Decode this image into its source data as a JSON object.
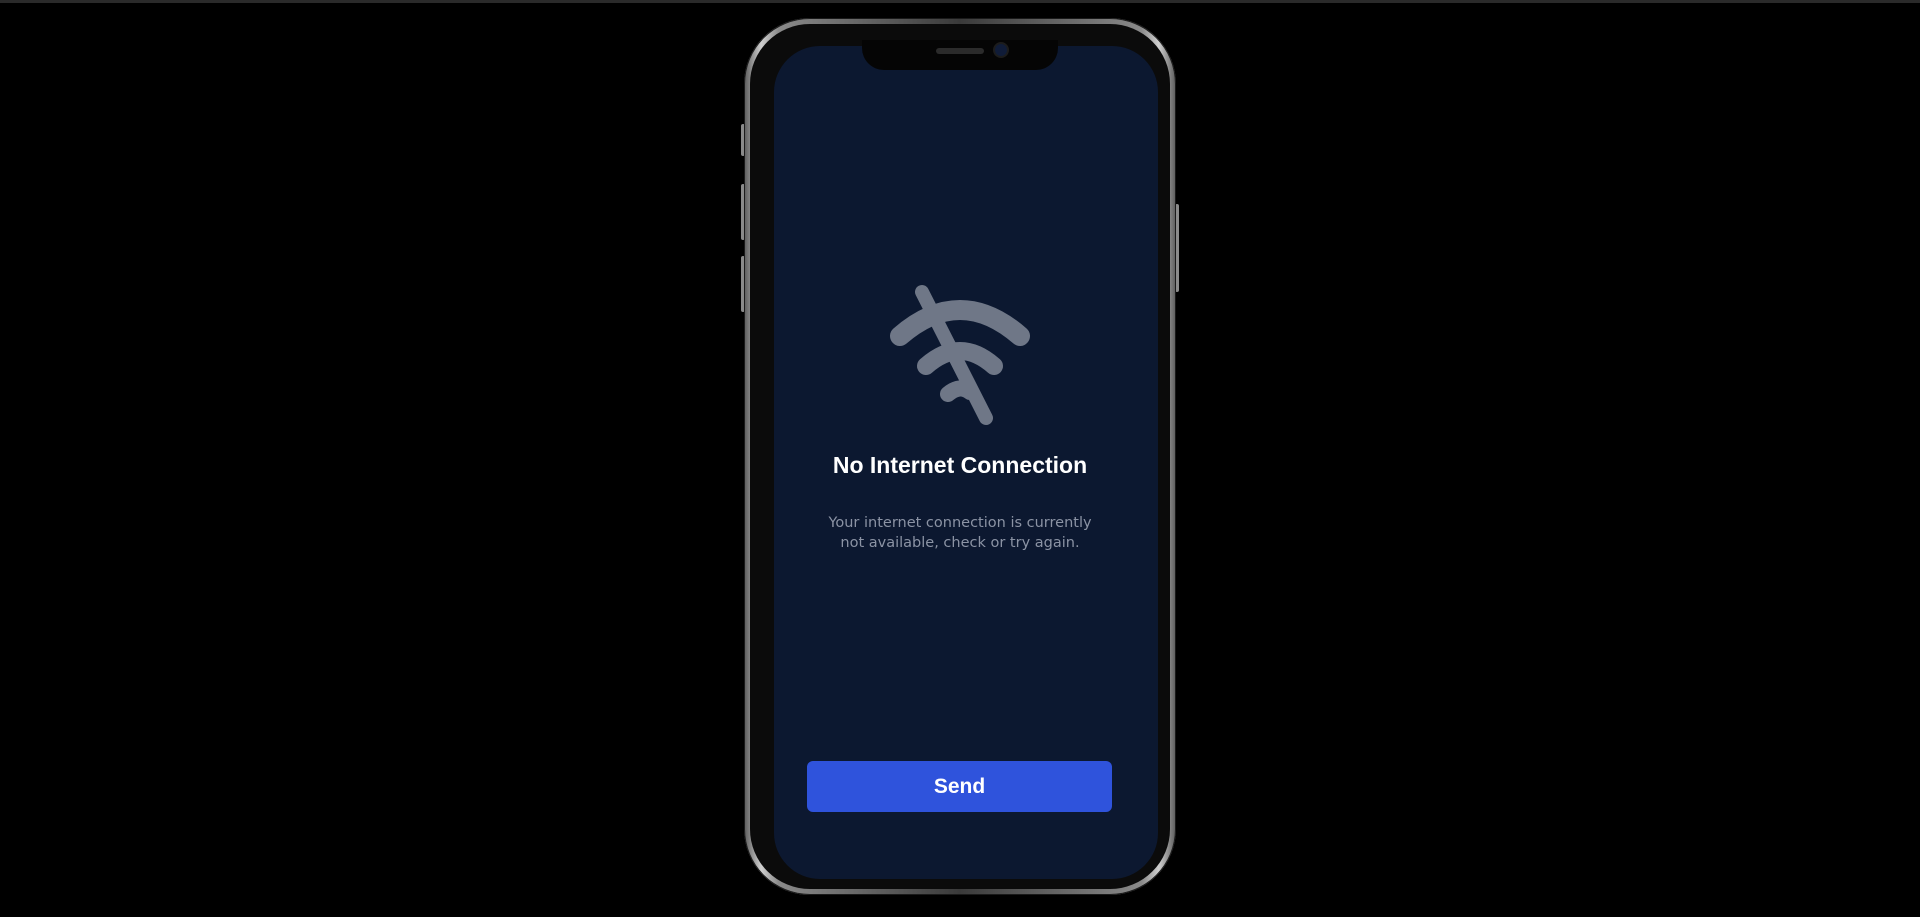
{
  "colors": {
    "page_background": "#000000",
    "screen_background": "#0c1830",
    "icon_color": "#6f7787",
    "title_color": "#ffffff",
    "subtitle_color": "#8b93a4",
    "button_background": "#2f53dc",
    "button_text": "#ffffff"
  },
  "device": {
    "type": "smartphone"
  },
  "error_screen": {
    "icon": "wifi-off-icon",
    "title": "No Internet Connection",
    "message_line1": "Your internet connection is currently",
    "message_line2": "not available, check or try again."
  },
  "actions": {
    "send_label": "Send"
  }
}
